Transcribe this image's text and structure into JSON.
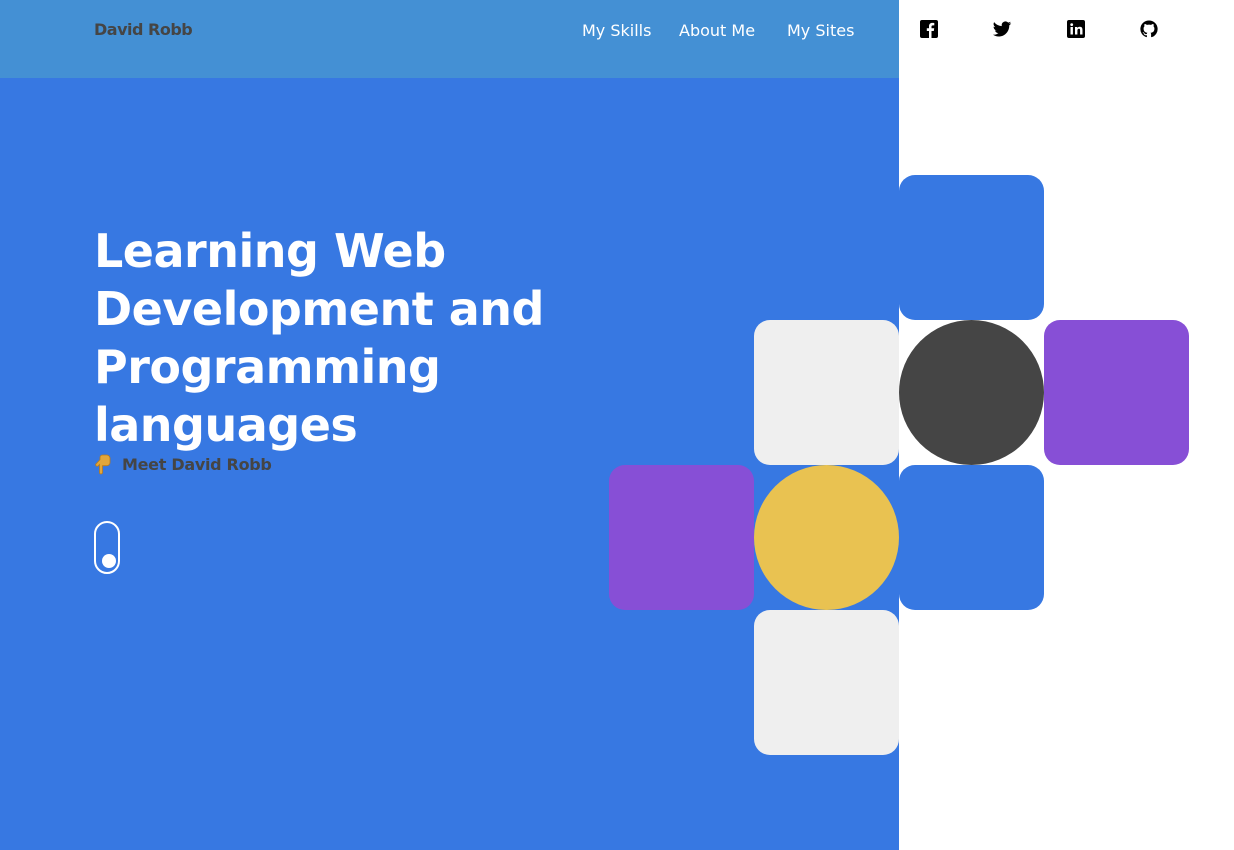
{
  "header": {
    "brand": "David Robb",
    "nav": [
      {
        "label": "My Skills"
      },
      {
        "label": "About Me"
      },
      {
        "label": "My Sites"
      }
    ],
    "social": [
      "facebook-icon",
      "twitter-icon",
      "linkedin-icon",
      "github-icon"
    ]
  },
  "hero": {
    "title": "Learning Web Development and Programming languages",
    "cta": "Meet David Robb",
    "cta_icon": "pointing-down-hand-icon"
  },
  "colors": {
    "primary_blue": "#3778e2",
    "header_blue": "#4490d4",
    "purple": "#874fd6",
    "yellow": "#e9c251",
    "light_gray": "#efefef",
    "dark_gray": "#454545",
    "white": "#ffffff"
  }
}
